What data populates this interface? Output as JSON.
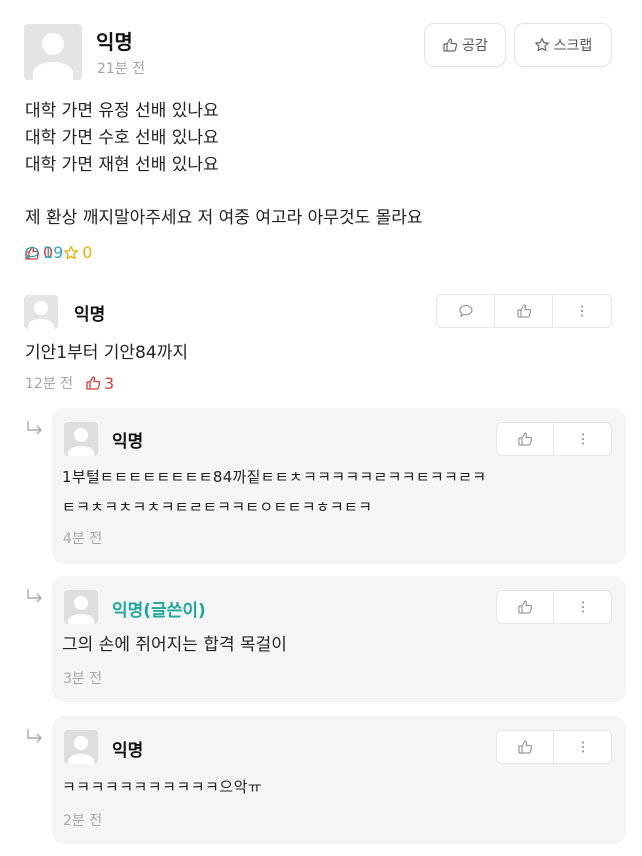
{
  "post": {
    "author": "익명",
    "time": "21분 전",
    "like_label": "공감",
    "scrap_label": "스크랩",
    "lines": [
      "대학 가면 유정 선배 있나요",
      "대학 가면 수호 선배 있나요",
      "대학 가면 재현 선배 있나요",
      "제 환상 깨지말아주세요 저 여중 여고라 아무것도 몰라요"
    ],
    "stats": {
      "likes": "0",
      "comments": "19",
      "scraps": "0"
    }
  },
  "comments": [
    {
      "author": "익명",
      "text": "기안1부터 기안84까지",
      "time": "12분 전",
      "likes": "3"
    }
  ],
  "replies": [
    {
      "author": "익명",
      "text1": "1부털ㅌㅌㅌㅌㅌㅌㅌㅌ84까짙ㅌㅌㅊㅋㅋㅋㅋㅋㄹㅋㅋㅌㅋㅋㄹㅋ",
      "text2": "ㅌㅋㅊㅋㅊㅋㅊㅋㅌㄹㅌㅋㅋㅌㅇㅌㅌㅋㅎㅋㅌㅋ",
      "time": "4분 전"
    },
    {
      "author": "익명(글쓴이)",
      "text1": "그의 손에 쥐어지는 합격 목걸이",
      "time": "3분 전"
    },
    {
      "author": "익명",
      "text1": "ㅋㅋㅋㅋㅋㅋㅋㅋㅋㅋㅋ으악ㅠ",
      "time": "2분 전"
    }
  ],
  "colors": {
    "like": "#e03a3a",
    "comment": "#2aa8c2",
    "scrap": "#e3b300",
    "writer": "#1ea8a0"
  }
}
